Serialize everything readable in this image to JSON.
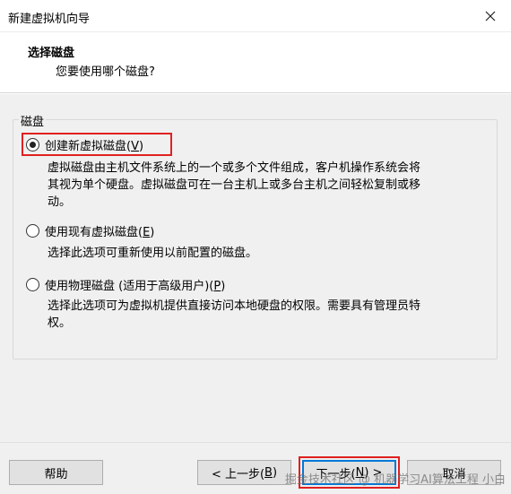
{
  "window": {
    "title": "新建虚拟机向导",
    "close_icon": "close-icon"
  },
  "header": {
    "title": "选择磁盘",
    "subtitle": "您要使用哪个磁盘?"
  },
  "group": {
    "label": "磁盘",
    "options": [
      {
        "label_prefix": "创建新虚拟磁盘(",
        "mnemonic": "V",
        "label_suffix": ")",
        "checked": true,
        "description": [
          "虚拟磁盘由主机文件系统上的一个或多个文件组成，客户机操作系统会将",
          "其视为单个硬盘。虚拟磁盘可在一台主机上或多台主机之间轻松复制或移",
          "动。"
        ]
      },
      {
        "label_prefix": "使用现有虚拟磁盘(",
        "mnemonic": "E",
        "label_suffix": ")",
        "checked": false,
        "description": [
          "选择此选项可重新使用以前配置的磁盘。"
        ]
      },
      {
        "label_prefix": "使用物理磁盘 (适用于高级用户)(",
        "mnemonic": "P",
        "label_suffix": ")",
        "checked": false,
        "description": [
          "选择此选项可为虚拟机提供直接访问本地硬盘的权限。需要具有管理员特",
          "权。"
        ]
      }
    ]
  },
  "buttons": {
    "help": "帮助",
    "back_prefix": "< 上一步(",
    "back_mnemonic": "B",
    "back_suffix": ")",
    "next_prefix": "下一步(",
    "next_mnemonic": "N",
    "next_suffix": ") >",
    "cancel": "取消"
  },
  "watermark": "掘金技术社区 @ 机器学习AI算法工程 小白",
  "colors": {
    "highlight": "#e02020",
    "dialog_bg": "#f0f0f0",
    "default_button_border": "#0078d7"
  }
}
